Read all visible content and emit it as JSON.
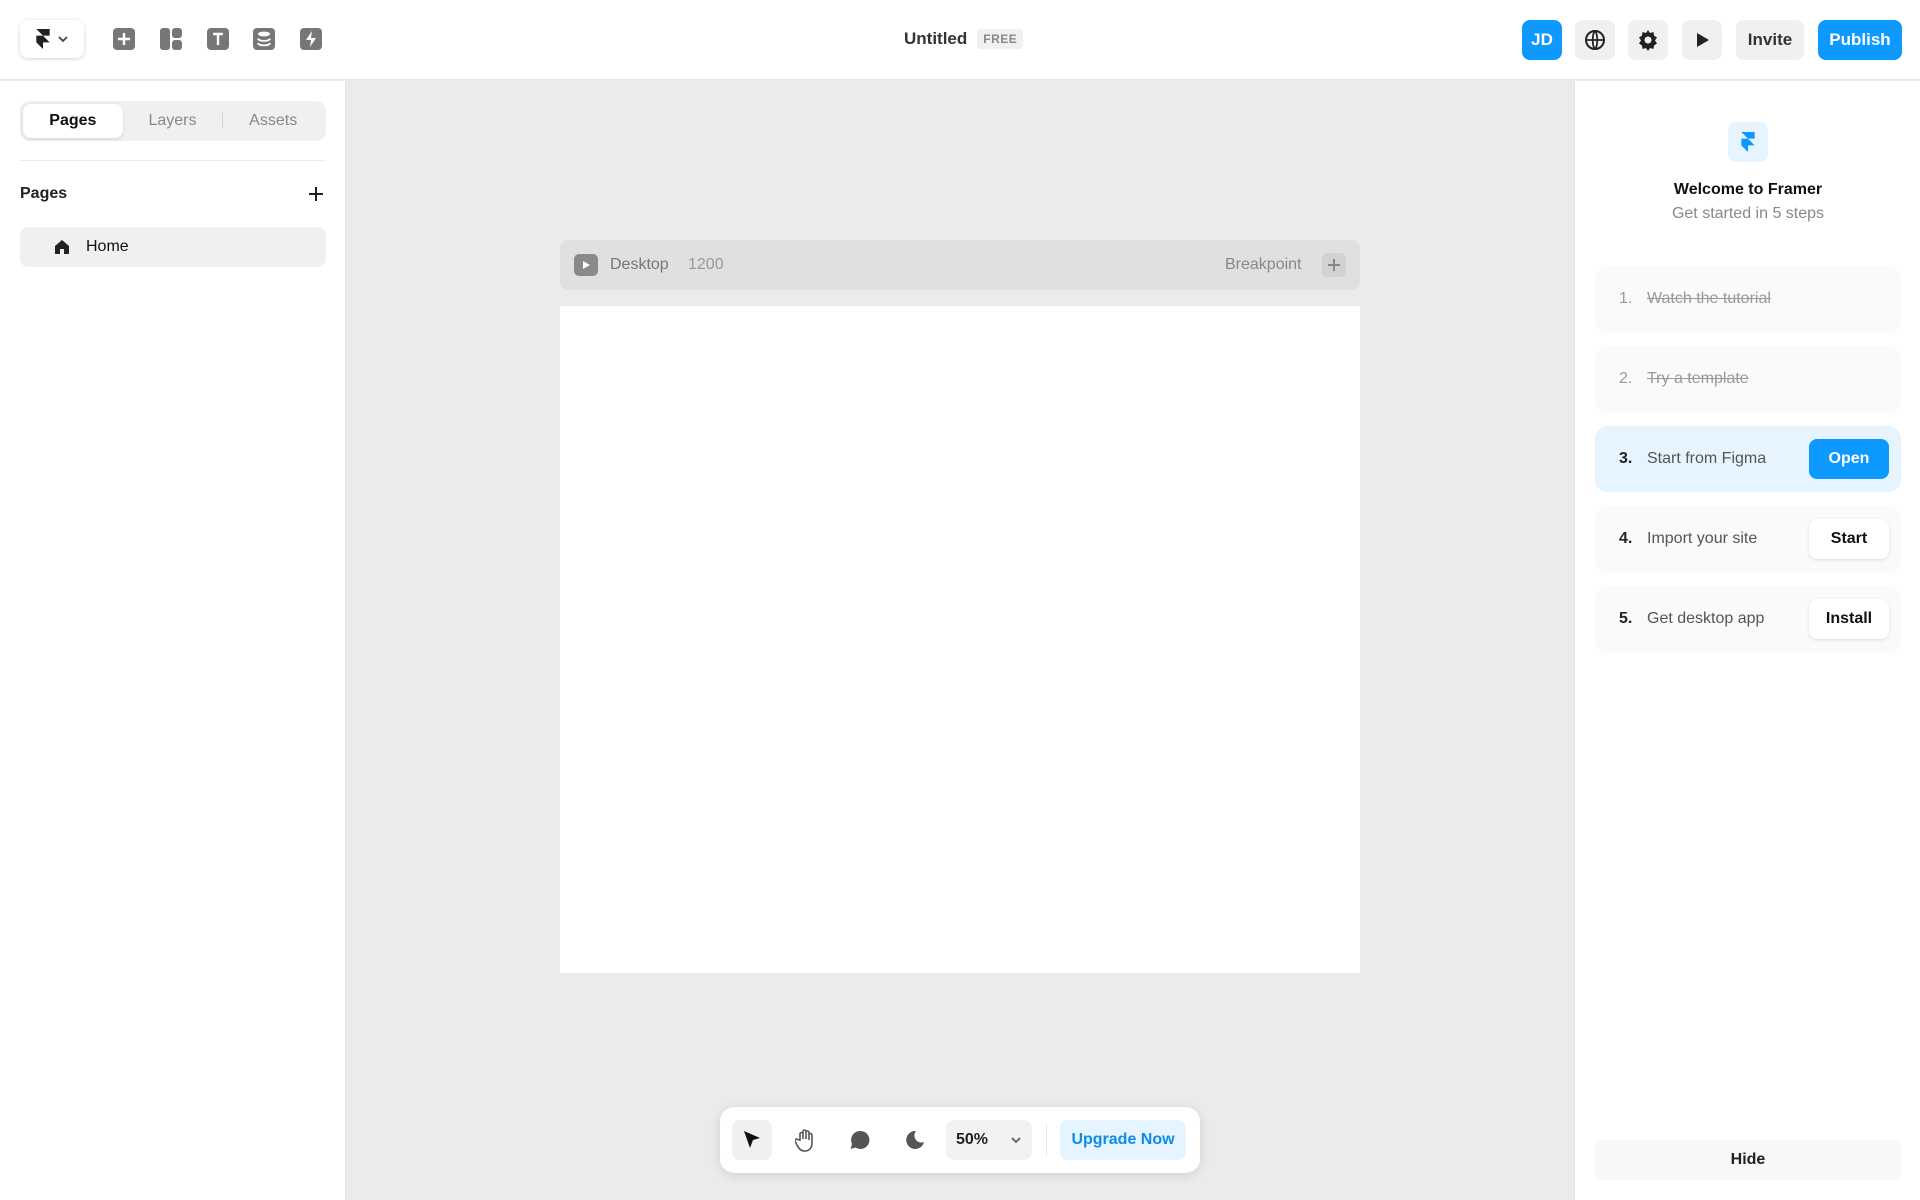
{
  "app": {
    "title": "Untitled",
    "plan_badge": "FREE"
  },
  "topbar": {
    "tools": [
      {
        "name": "insert-icon"
      },
      {
        "name": "layout-icon"
      },
      {
        "name": "text-icon"
      },
      {
        "name": "cms-icon"
      },
      {
        "name": "interactions-icon"
      }
    ],
    "avatar_initials": "JD",
    "invite_label": "Invite",
    "publish_label": "Publish",
    "accent_color": "#0d99ff"
  },
  "left_panel": {
    "tabs": [
      {
        "label": "Pages",
        "active": true
      },
      {
        "label": "Layers",
        "active": false
      },
      {
        "label": "Assets",
        "active": false
      }
    ],
    "section_title": "Pages",
    "pages": [
      {
        "label": "Home",
        "icon": "home-icon"
      }
    ]
  },
  "canvas": {
    "breakpoint_name": "Desktop",
    "breakpoint_width": "1200",
    "breakpoint_label": "Breakpoint"
  },
  "bottom_toolbar": {
    "zoom": "50%",
    "upgrade_label": "Upgrade Now"
  },
  "right_panel": {
    "title": "Welcome to Framer",
    "subtitle": "Get started in 5 steps",
    "steps": [
      {
        "num": "1.",
        "text": "Watch the tutorial",
        "done": true
      },
      {
        "num": "2.",
        "text": "Try a template",
        "done": true
      },
      {
        "num": "3.",
        "text": "Start from Figma",
        "button": "Open"
      },
      {
        "num": "4.",
        "text": "Import your site",
        "button": "Start"
      },
      {
        "num": "5.",
        "text": "Get desktop app",
        "button": "Install"
      }
    ],
    "hide_label": "Hide"
  }
}
